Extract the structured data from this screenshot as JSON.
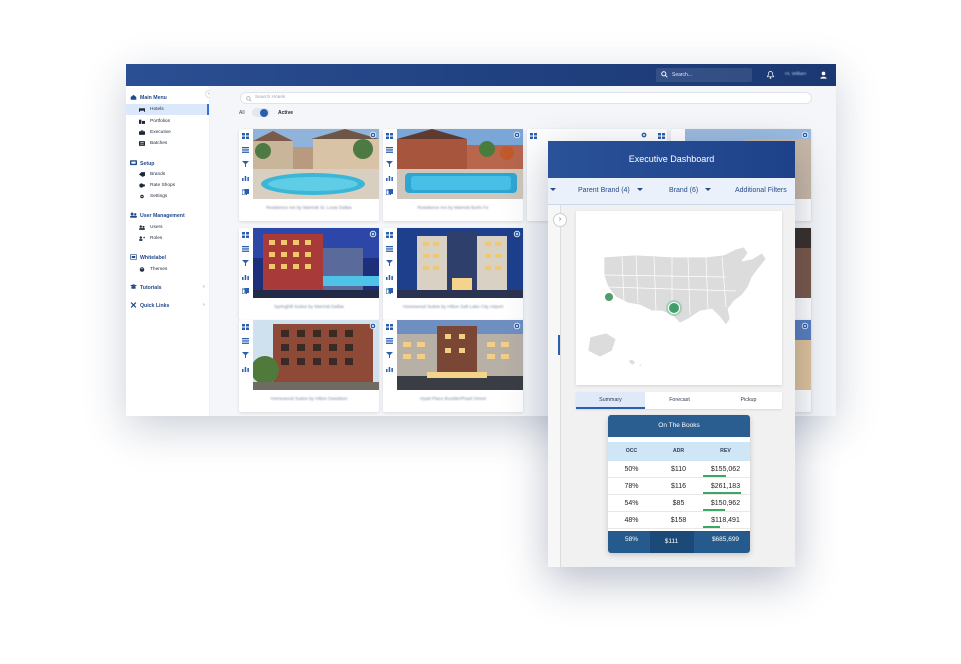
{
  "topbar": {
    "search_placeholder": "Search...",
    "user_name": "Hi, William"
  },
  "sidebar": {
    "main_menu_title": "Main Menu",
    "main_items": [
      {
        "label": "Hotels",
        "icon": "hotel-icon",
        "active": true
      },
      {
        "label": "Portfolios",
        "icon": "portfolio-icon"
      },
      {
        "label": "Executive",
        "icon": "briefcase-icon"
      },
      {
        "label": "Batches",
        "icon": "batch-icon"
      }
    ],
    "setup_title": "Setup",
    "setup_items": [
      {
        "label": "Brands",
        "icon": "tag-icon"
      },
      {
        "label": "Rate Shops",
        "icon": "shop-icon"
      },
      {
        "label": "Settings",
        "icon": "gear-icon"
      }
    ],
    "user_mgmt_title": "User Management",
    "user_items": [
      {
        "label": "Users",
        "icon": "users-icon"
      },
      {
        "label": "Roles",
        "icon": "roles-icon"
      }
    ],
    "whitelabel_title": "Whitelabel",
    "whitelabel_items": [
      {
        "label": "Themes",
        "icon": "palette-icon"
      }
    ],
    "tutorials_label": "Tutorials",
    "quick_links_label": "Quick Links"
  },
  "main": {
    "search_placeholder": "Search Hotels",
    "toggle_all_label": "All",
    "toggle_active_label": "Active",
    "toggle_state": "Active",
    "hotels": [
      {
        "name": "Residence Inn by Marriott St. Louis Dallas",
        "scene": "pool-courtyard"
      },
      {
        "name": "Residence Inn by Marriott Burlo Fe",
        "scene": "pool-brick"
      },
      {
        "name": "Springhill Suites by Marriott Dallas",
        "scene": "night-red"
      },
      {
        "name": "Homewood Suites by Hilton Salt Lake City Airport",
        "scene": "night-blue"
      },
      {
        "name": "Homewood Suites by Hilton Davidson",
        "scene": "brick-day"
      },
      {
        "name": "Hyatt Place Boulder/Pearl Street",
        "scene": "dusk-urban"
      }
    ]
  },
  "executive": {
    "title": "Executive Dashboard",
    "filters": [
      "Parent Brand (4)",
      "Brand (6)",
      "Additional Filters"
    ],
    "tabs": [
      "Summary",
      "Forecast",
      "Pickup"
    ],
    "active_tab": "Summary",
    "otb_title": "On The Books",
    "columns": [
      "OCC",
      "ADR",
      "REV"
    ],
    "rows": [
      {
        "occ": "50%",
        "adr": "$110",
        "rev": "$155,062",
        "rev_fraction": 0.57
      },
      {
        "occ": "78%",
        "adr": "$116",
        "rev": "$261,183",
        "rev_fraction": 0.95
      },
      {
        "occ": "54%",
        "adr": "$85",
        "rev": "$150,962",
        "rev_fraction": 0.55
      },
      {
        "occ": "48%",
        "adr": "$158",
        "rev": "$118,491",
        "rev_fraction": 0.43
      }
    ],
    "total": {
      "occ": "58%",
      "adr": "$111",
      "rev": "$685,699"
    }
  },
  "colors": {
    "brand": "#1f3f7e",
    "accent": "#2a5fae",
    "table_header": "#2a5e90",
    "bar": "#3aa769",
    "marker": "#3f9e6a"
  }
}
